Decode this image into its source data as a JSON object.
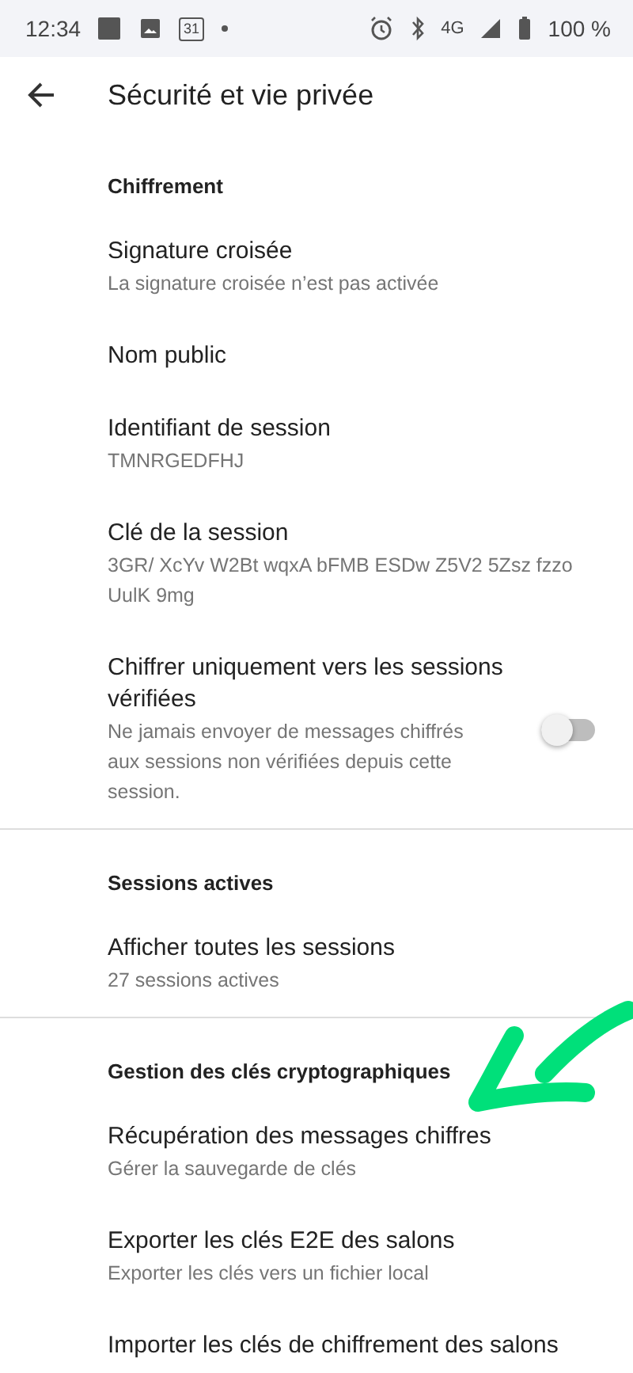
{
  "status_bar": {
    "time": "12:34",
    "calendar_day": "31",
    "network": "4G",
    "battery": "100 %"
  },
  "header": {
    "title": "Sécurité et vie privée"
  },
  "sections": [
    {
      "title": "Chiffrement",
      "items": [
        {
          "kind": "text",
          "title": "Signature croisée",
          "subtitle": "La signature croisée n’est pas activée"
        },
        {
          "kind": "text",
          "title": "Nom public"
        },
        {
          "kind": "text",
          "title": "Identifiant de session",
          "subtitle": "TMNRGEDFHJ"
        },
        {
          "kind": "text",
          "title": "Clé de la session",
          "subtitle": "3GR/ XcYv W2Bt wqxA bFMB ESDw Z5V2 5Zsz fzzo UulK 9mg"
        },
        {
          "kind": "switch",
          "title": "Chiffrer uniquement vers les sessions vérifiées",
          "subtitle": "Ne jamais envoyer de messages chiffrés aux sessions non vérifiées depuis cette session.",
          "on": false
        }
      ]
    },
    {
      "title": "Sessions actives",
      "items": [
        {
          "kind": "text",
          "title": "Afficher toutes les sessions",
          "subtitle": "27 sessions actives"
        }
      ]
    },
    {
      "title": "Gestion des clés cryptographiques",
      "items": [
        {
          "kind": "text",
          "title": "Récupération des messages chiffres",
          "subtitle": "Gérer la sauvegarde de clés"
        },
        {
          "kind": "text",
          "title": "Exporter les clés E2E des salons",
          "subtitle": "Exporter les clés vers un fichier local"
        },
        {
          "kind": "text",
          "title": "Importer les clés de chiffrement des salons"
        }
      ]
    }
  ]
}
